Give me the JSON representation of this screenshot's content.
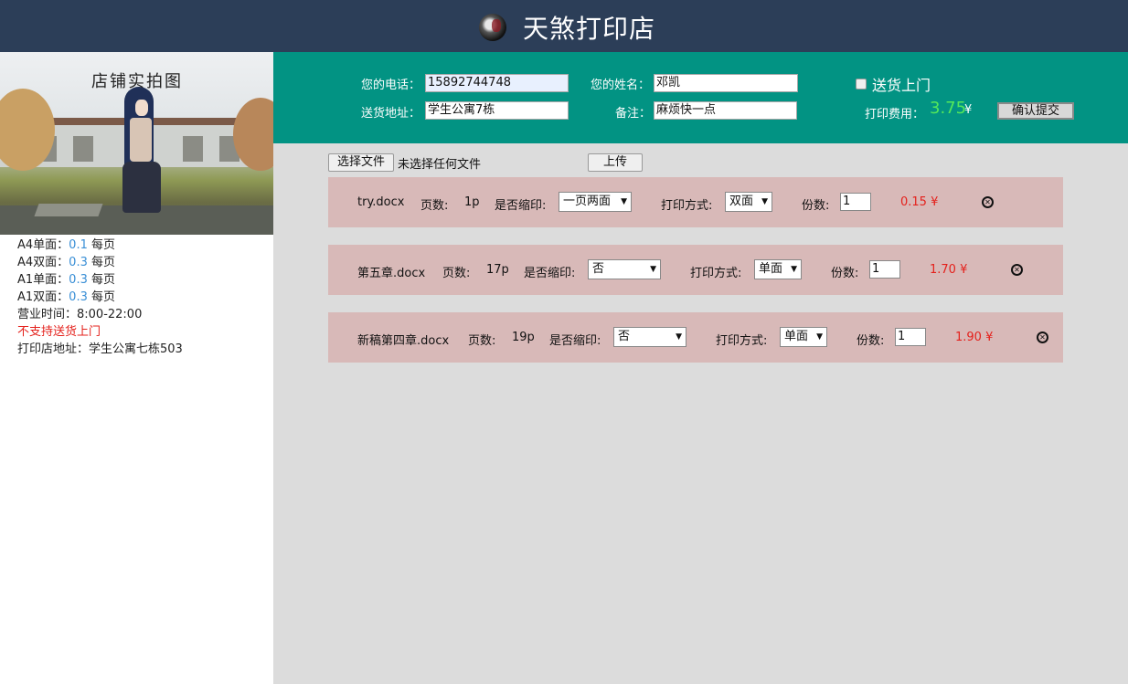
{
  "header": {
    "title": "天煞打印店",
    "logo": "avatar-icon"
  },
  "sidebar": {
    "photo_caption": "店铺实拍图",
    "prices": [
      {
        "label": "A4单面：",
        "value": "0.1",
        "unit": "每页"
      },
      {
        "label": "A4双面：",
        "value": "0.3",
        "unit": "每页"
      },
      {
        "label": "A1单面：",
        "value": "0.3",
        "unit": "每页"
      },
      {
        "label": "A1双面：",
        "value": "0.3",
        "unit": "每页"
      }
    ],
    "hours": "营业时间：8:00-22:00",
    "delivery_notice": "不支持送货上门",
    "address": "打印店地址：学生公寓七栋503"
  },
  "form": {
    "phone_label": "您的电话：",
    "phone_value": "15892744748",
    "name_label": "您的姓名：",
    "name_value": "邓凯",
    "address_label": "送货地址：",
    "address_value": "学生公寓7栋",
    "remark_label": "备注：",
    "remark_value": "麻烦快一点",
    "deliver_label": "送货上门",
    "deliver_checked": false,
    "fee_label": "打印费用：",
    "fee_value": "3.75",
    "fee_unit": "¥",
    "submit_label": "确认提交"
  },
  "uploader": {
    "choose_label": "选择文件",
    "no_file_text": "未选择任何文件",
    "upload_label": "上传"
  },
  "files": [
    {
      "name": "try.docx",
      "pages_label": "页数:",
      "pages": "1p",
      "shrink_label": "是否缩印:",
      "shrink": "一页两面",
      "mode_label": "打印方式:",
      "mode": "双面",
      "copies_label": "份数:",
      "copies": "1",
      "cost": "0.15 ¥"
    },
    {
      "name": "第五章.docx",
      "pages_label": "页数:",
      "pages": "17p",
      "shrink_label": "是否缩印:",
      "shrink": "否",
      "mode_label": "打印方式:",
      "mode": "单面",
      "copies_label": "份数:",
      "copies": "1",
      "cost": "1.70 ¥"
    },
    {
      "name": "新稿第四章.docx",
      "pages_label": "页数:",
      "pages": "19p",
      "shrink_label": "是否缩印:",
      "shrink": "否",
      "mode_label": "打印方式:",
      "mode": "单面",
      "copies_label": "份数:",
      "copies": "1",
      "cost": "1.90 ¥"
    }
  ]
}
